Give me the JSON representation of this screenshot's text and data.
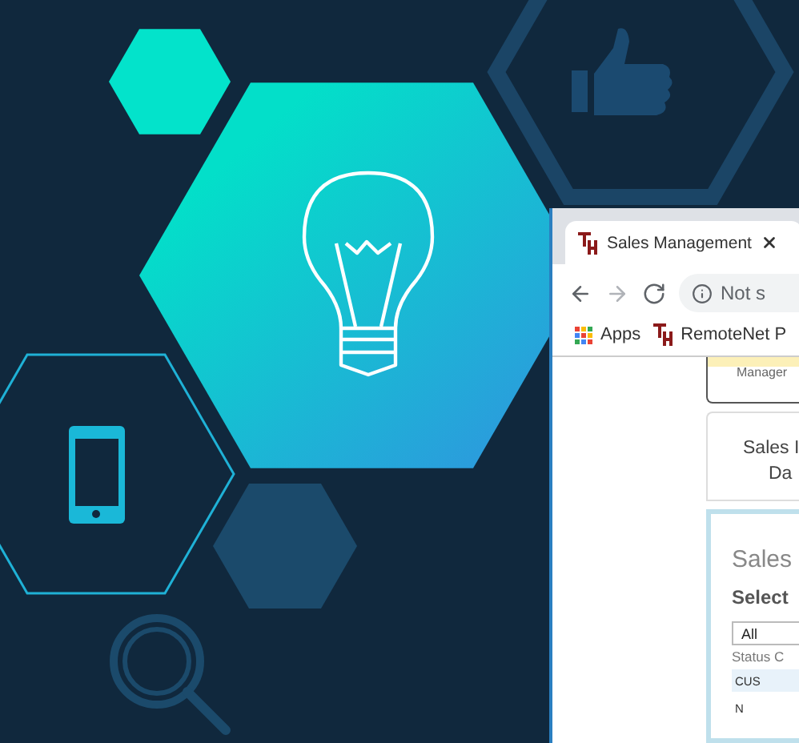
{
  "browser": {
    "tab": {
      "title": "Sales Management"
    },
    "nav": [
      {
        "kind": "back",
        "disabled": false
      },
      {
        "kind": "forward",
        "disabled": true
      },
      {
        "kind": "reload",
        "disabled": false
      }
    ],
    "address": {
      "text": "Not s"
    },
    "bookmarks": [
      {
        "kind": "apps",
        "label": "Apps"
      },
      {
        "kind": "site",
        "label": "RemoteNet P"
      }
    ],
    "page": {
      "banner": "Manager",
      "card_lines": [
        "Sales I",
        "Da"
      ],
      "panel": {
        "title": "Sales",
        "subtitle": "Select",
        "select_value": "All",
        "column": "Status C",
        "rows": [
          "CUS",
          "N"
        ]
      }
    }
  }
}
